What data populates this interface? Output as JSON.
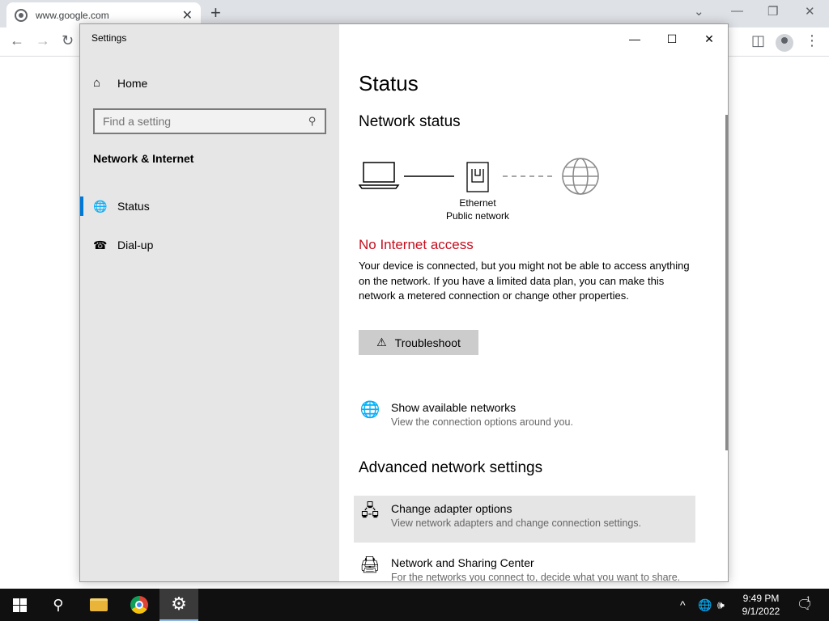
{
  "browser": {
    "tab_title": "www.google.com",
    "tab_close": "✕",
    "new_tab": "+",
    "dropdown": "⌄",
    "minimize": "—",
    "restore": "❐",
    "close": "✕",
    "back": "←",
    "forward": "→",
    "reload": "↻",
    "sidepanel": "◫",
    "menu": "⋮"
  },
  "window": {
    "title": "Settings",
    "minimize": "—",
    "maximize": "☐",
    "close": "✕"
  },
  "sidebar": {
    "home_label": "Home",
    "home_icon": "⌂",
    "search_placeholder": "Find a setting",
    "search_icon": "⚲",
    "section": "Network & Internet",
    "items": [
      {
        "label": "Status",
        "icon": "globe-icon",
        "glyph": "🌐",
        "active": true
      },
      {
        "label": "Dial-up",
        "icon": "dialup-icon",
        "glyph": "☎",
        "active": false
      }
    ]
  },
  "main": {
    "title": "Status",
    "network_status_heading": "Network status",
    "diagram": {
      "adapter_name": "Ethernet",
      "network_profile": "Public network"
    },
    "connection_state": "No Internet access",
    "description": "Your device is connected, but you might not be able to access anything on the network. If you have a limited data plan, you can make this network a metered connection or change other properties.",
    "troubleshoot_label": "Troubleshoot",
    "troubleshoot_icon": "⚠",
    "show_networks": {
      "title": "Show available networks",
      "subtitle": "View the connection options around you.",
      "icon": "🌐"
    },
    "advanced_heading": "Advanced network settings",
    "adapter_options": {
      "title": "Change adapter options",
      "subtitle": "View network adapters and change connection settings.",
      "icon": "🖧"
    },
    "sharing_center": {
      "title": "Network and Sharing Center",
      "subtitle": "For the networks you connect to, decide what you want to share.",
      "icon": "🖨"
    }
  },
  "taskbar": {
    "search_icon": "⚲",
    "settings_icon": "⚙",
    "chevron": "^",
    "network_icon": "🌐",
    "volume_icon": "🕪",
    "time": "9:49 PM",
    "date": "9/1/2022",
    "notification_icon": "🗨",
    "notification_count": "1"
  },
  "colors": {
    "accent": "#0078d7",
    "error": "#c50f1f",
    "sidebar_bg": "#e6e6e6"
  }
}
